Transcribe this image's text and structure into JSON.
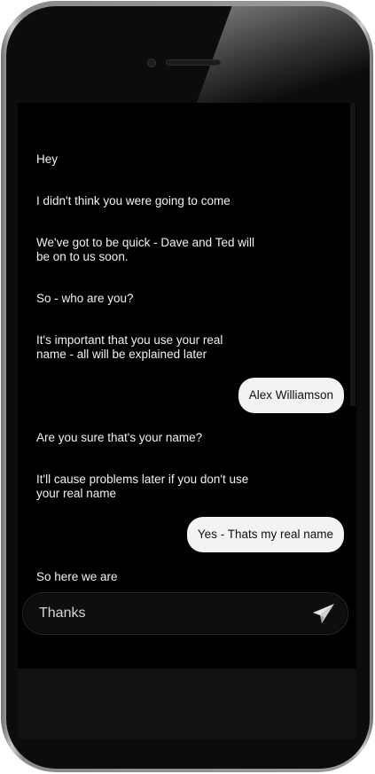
{
  "chat": {
    "messages": [
      {
        "from": "them",
        "text": "Hey"
      },
      {
        "from": "them",
        "text": "I didn't think you were going to come"
      },
      {
        "from": "them",
        "text": "We've got to be quick - Dave and Ted will be on to us soon."
      },
      {
        "from": "them",
        "text": "So - who are you?"
      },
      {
        "from": "them",
        "text": "It's important that you use your real name - all will be explained later"
      },
      {
        "from": "me",
        "text": "Alex Williamson"
      },
      {
        "from": "them",
        "text": "Are you sure that's your name?"
      },
      {
        "from": "them",
        "text": "It'll cause problems later if you don't use your real name"
      },
      {
        "from": "me",
        "text": "Yes - Thats my real name"
      },
      {
        "from": "them",
        "text": "So here we are"
      }
    ]
  },
  "composer": {
    "value": "Thanks",
    "send_icon": "paper-plane-icon"
  },
  "colors": {
    "screen_background": "#000000",
    "incoming_text": "#f2f2f2",
    "outgoing_bubble": "#f3f3f3",
    "outgoing_text": "#111111"
  }
}
